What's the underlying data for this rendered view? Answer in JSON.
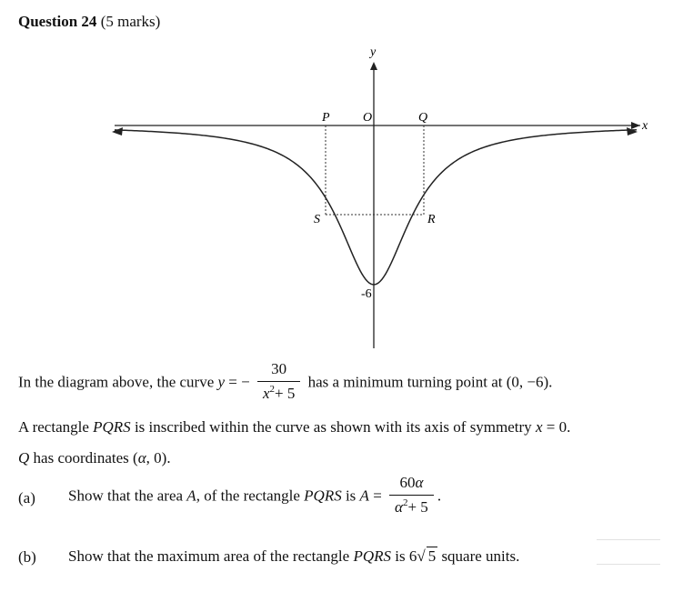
{
  "question": {
    "title": "Question 24",
    "marks": "(5 marks)"
  },
  "diagram": {
    "axis_x": "x",
    "axis_y": "y",
    "label_p": "P",
    "label_o": "O",
    "label_q": "Q",
    "label_s": "S",
    "label_r": "R",
    "label_min": "-6"
  },
  "intro": {
    "prefix": "In the diagram above, the curve ",
    "y_var": "y",
    "eq": " = −",
    "frac_num": "30",
    "frac_den_base": "x",
    "frac_den_exp": "2",
    "frac_den_tail": "+ 5",
    "suffix": "has a minimum turning point at (0, −6)."
  },
  "rect_line": {
    "prefix": "A rectangle ",
    "name": "PQRS",
    "middle": " is inscribed within the curve as shown with its axis of symmetry ",
    "eq_var": "x",
    "eq_rest": " = 0."
  },
  "q_line": {
    "q": "Q",
    "rest": " has coordinates (",
    "alpha": "α",
    "tail": ", 0)."
  },
  "part_a": {
    "label": "(a)",
    "prefix": "Show that the area ",
    "a_var": "A",
    "mid": ", of the rectangle ",
    "name": "PQRS",
    "is": " is ",
    "a_var2": "A",
    "eq": " = ",
    "frac_num_coef": "60",
    "frac_num_var": "α",
    "frac_den_base": "α",
    "frac_den_exp": "2",
    "frac_den_tail": "+ 5",
    "end": "."
  },
  "part_b": {
    "label": "(b)",
    "prefix": "Show that the maximum area of the rectangle ",
    "name": "PQRS",
    "is": " is 6",
    "sqrt_rad": "5",
    "suffix": " square units."
  }
}
